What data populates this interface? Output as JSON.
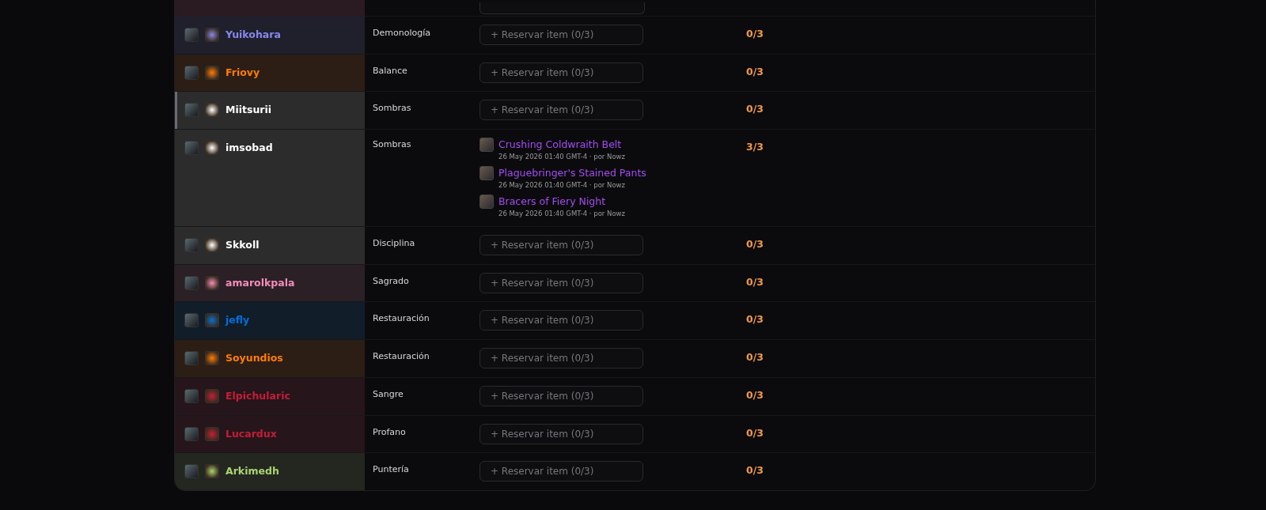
{
  "rows": [
    {
      "name": "Yuikohara",
      "color": "#8788ee",
      "spec": "Demonología",
      "selected": false,
      "reserve_button": "+ Reservar item (0/3)",
      "count": "0/3"
    },
    {
      "name": "Friovy",
      "color": "#ff7c0a",
      "spec": "Balance",
      "selected": false,
      "reserve_button": "+ Reservar item (0/3)",
      "count": "0/3"
    },
    {
      "name": "Miitsurii",
      "color": "#ffffff",
      "spec": "Sombras",
      "selected": true,
      "reserve_button": "+ Reservar item (0/3)",
      "count": "0/3"
    },
    {
      "name": "imsobad",
      "color": "#ffffff",
      "spec": "Sombras",
      "selected": false,
      "items": [
        {
          "name": "Crushing Coldwraith Belt",
          "meta": "26 May 2026 01:40 GMT-4 · por Nowz"
        },
        {
          "name": "Plaguebringer's Stained Pants",
          "meta": "26 May 2026 01:40 GMT-4 · por Nowz"
        },
        {
          "name": "Bracers of Fiery Night",
          "meta": "26 May 2026 01:40 GMT-4 · por Nowz"
        }
      ],
      "count": "3/3"
    },
    {
      "name": "Skkoll",
      "color": "#ffffff",
      "spec": "Disciplina",
      "selected": false,
      "reserve_button": "+ Reservar item (0/3)",
      "count": "0/3"
    },
    {
      "name": "amarolkpala",
      "color": "#f48cba",
      "spec": "Sagrado",
      "selected": false,
      "reserve_button": "+ Reservar item (0/3)",
      "count": "0/3"
    },
    {
      "name": "jefly",
      "color": "#0070dd",
      "spec": "Restauración",
      "selected": false,
      "reserve_button": "+ Reservar item (0/3)",
      "count": "0/3"
    },
    {
      "name": "Soyundios",
      "color": "#ff7c0a",
      "spec": "Restauración",
      "selected": false,
      "reserve_button": "+ Reservar item (0/3)",
      "count": "0/3"
    },
    {
      "name": "Elpichularic",
      "color": "#c41e3a",
      "spec": "Sangre",
      "selected": false,
      "reserve_button": "+ Reservar item (0/3)",
      "count": "0/3"
    },
    {
      "name": "Lucardux",
      "color": "#c41e3a",
      "spec": "Profano",
      "selected": false,
      "reserve_button": "+ Reservar item (0/3)",
      "count": "0/3"
    },
    {
      "name": "Arkimedh",
      "color": "#aad372",
      "spec": "Puntería",
      "selected": false,
      "reserve_button": "+ Reservar item (0/3)",
      "count": "0/3"
    }
  ]
}
